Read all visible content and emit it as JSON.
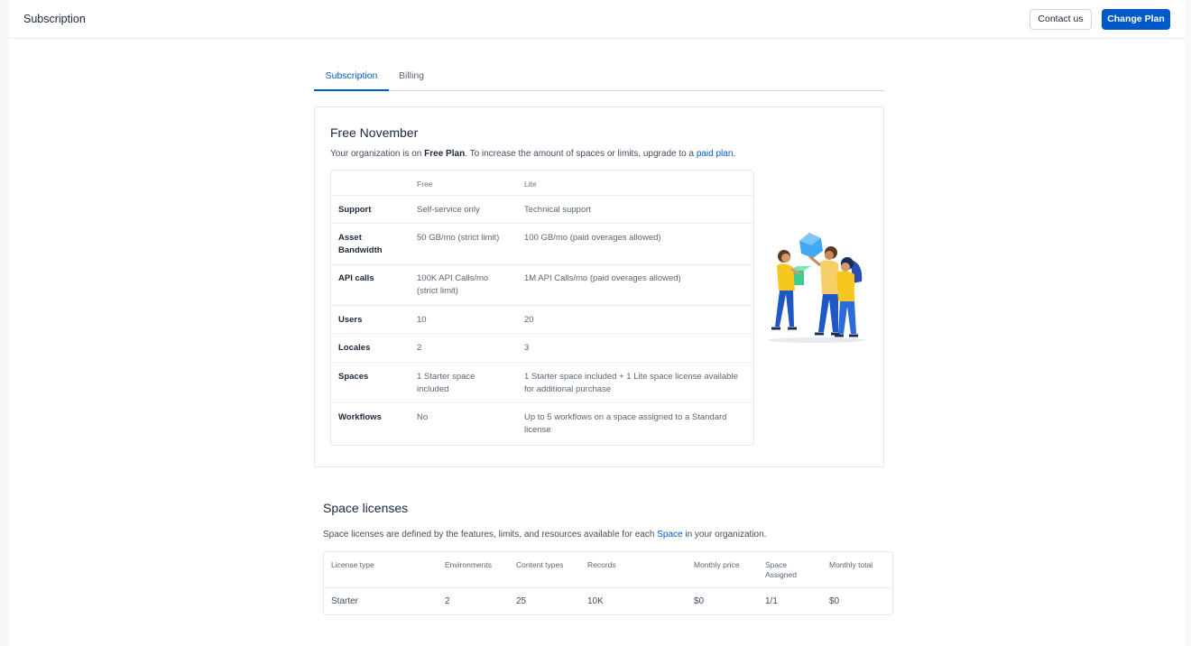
{
  "header": {
    "title": "Subscription",
    "contact_label": "Contact us",
    "change_plan_label": "Change Plan"
  },
  "tabs": [
    {
      "label": "Subscription",
      "active": true
    },
    {
      "label": "Billing",
      "active": false
    }
  ],
  "plan_card": {
    "title": "Free November",
    "desc_prefix": "Your organization is on ",
    "desc_plan": "Free Plan",
    "desc_middle": ". To increase the amount of spaces or limits, upgrade to a ",
    "desc_link": "paid plan",
    "desc_suffix": ".",
    "table": {
      "headers": [
        "",
        "Free",
        "Lite"
      ],
      "rows": [
        {
          "feature": "Support",
          "free": "Self-service only",
          "lite": "Technical support"
        },
        {
          "feature": "Asset Bandwidth",
          "free": "50 GB/mo (strict limit)",
          "lite": "100 GB/mo (paid overages allowed)"
        },
        {
          "feature": "API calls",
          "free": "100K API Calls/mo (strict limit)",
          "lite": "1M API Calls/mo (paid overages allowed)"
        },
        {
          "feature": "Users",
          "free": "10",
          "lite": "20"
        },
        {
          "feature": "Locales",
          "free": "2",
          "lite": "3"
        },
        {
          "feature": "Spaces",
          "free": "1 Starter space included",
          "lite": "1 Starter space included + 1 Lite space license available for additional purchase"
        },
        {
          "feature": "Workflows",
          "free": "No",
          "lite": "Up to 5 workflows on a space assigned to a Standard license"
        }
      ]
    }
  },
  "space_licenses": {
    "title": "Space licenses",
    "desc_prefix": "Space licenses are defined by the features, limits, and resources available for each ",
    "desc_link": "Space",
    "desc_suffix": " in your organization.",
    "columns": [
      "License type",
      "Environments",
      "Content types",
      "Records",
      "Monthly price",
      "Space Assigned",
      "Monthly total"
    ],
    "rows": [
      [
        "Starter",
        "2",
        "25",
        "10K",
        "$0",
        "1/1",
        "$0"
      ]
    ]
  },
  "colors": {
    "accent": "#0059c8",
    "text": "#1b273a",
    "muted": "#5a6574"
  }
}
